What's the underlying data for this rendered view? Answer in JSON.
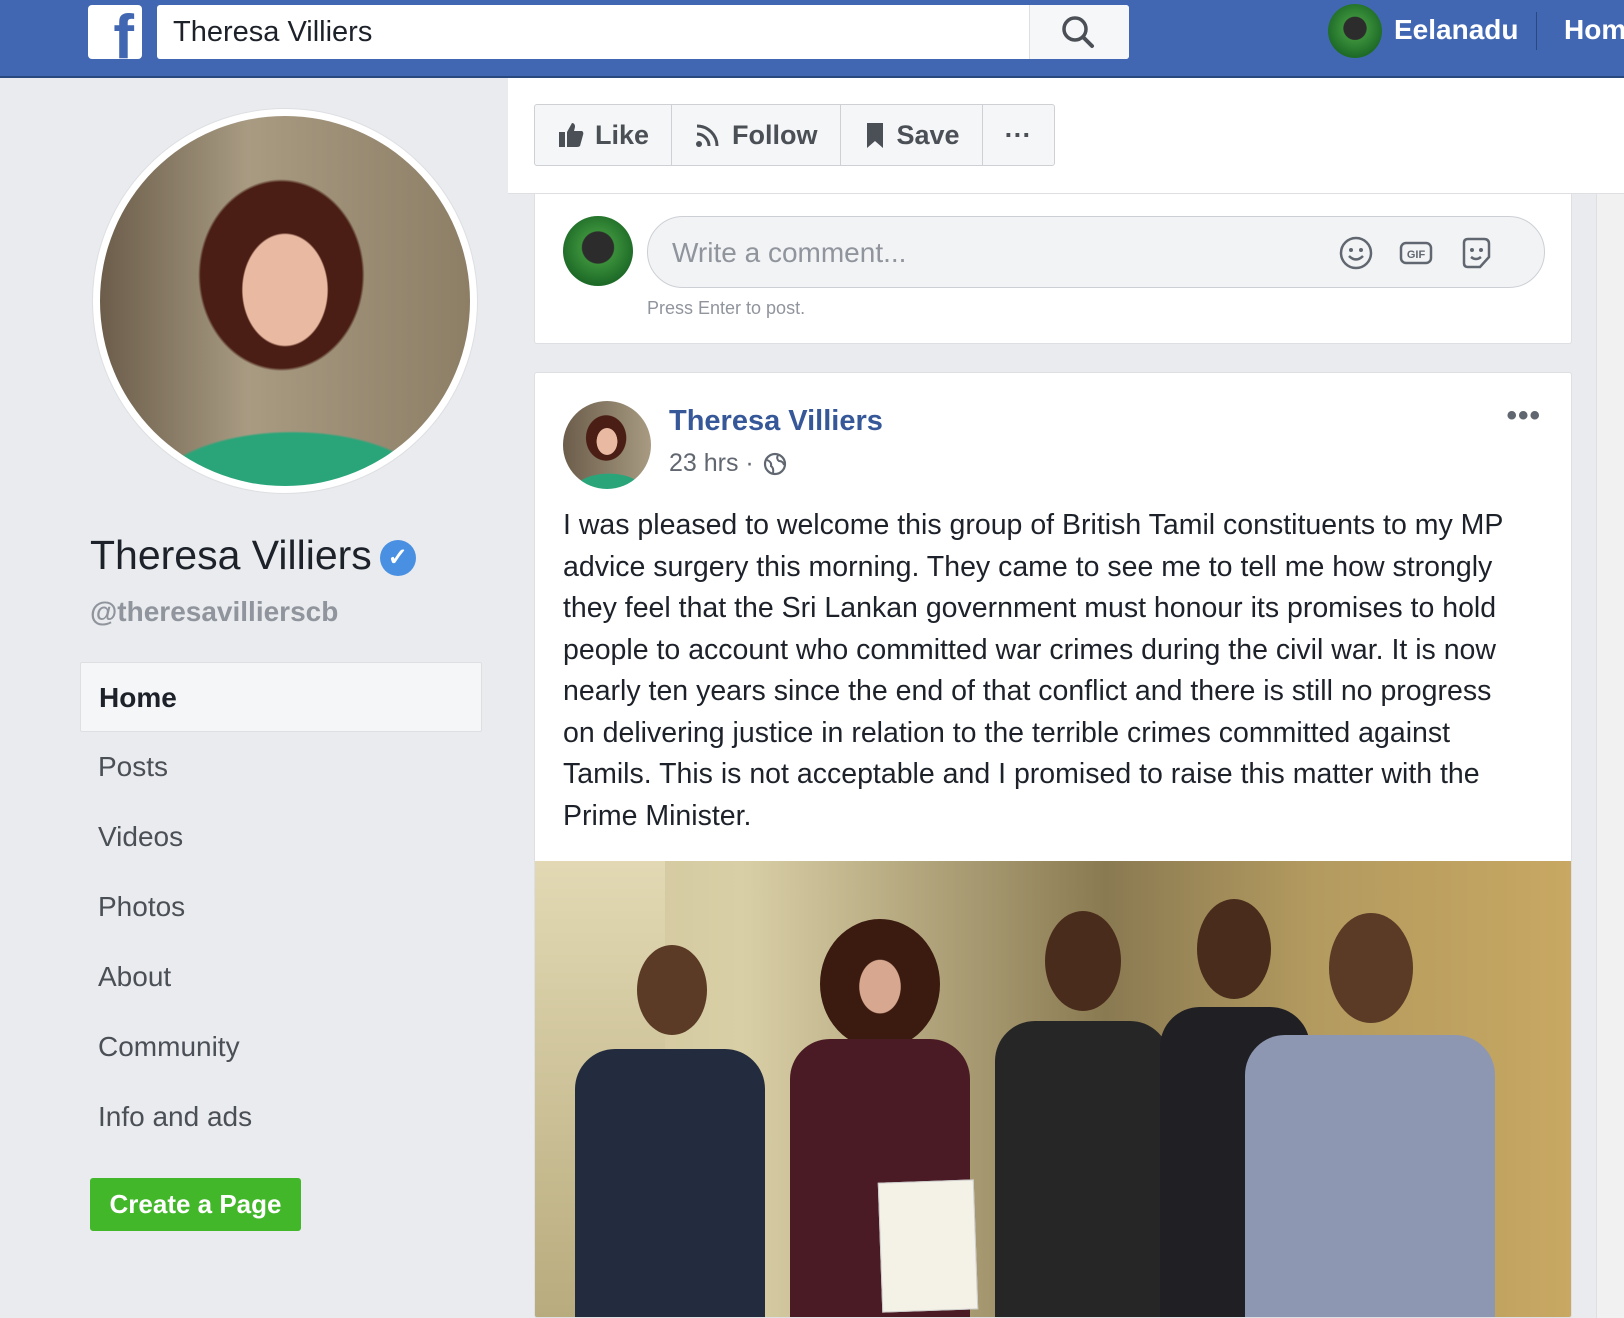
{
  "topbar": {
    "search_value": "Theresa Villiers",
    "user_name": "Eelanadu",
    "home_label": "Home"
  },
  "profile": {
    "name": "Theresa Villiers",
    "handle": "@theresavillierscb",
    "verified_mark": "✓"
  },
  "nav": {
    "items": [
      {
        "label": "Home"
      },
      {
        "label": "Posts"
      },
      {
        "label": "Videos"
      },
      {
        "label": "Photos"
      },
      {
        "label": "About"
      },
      {
        "label": "Community"
      },
      {
        "label": "Info and ads"
      }
    ],
    "create_page": "Create a Page"
  },
  "actions": {
    "like": "Like",
    "follow": "Follow",
    "save": "Save",
    "more": "···"
  },
  "comment": {
    "placeholder": "Write a comment...",
    "hint": "Press Enter to post."
  },
  "post": {
    "author": "Theresa Villiers",
    "time": "23 hrs ·",
    "more": "•••",
    "text": "I was pleased to welcome this group of British Tamil constituents to my MP advice surgery this morning. They came to see me to tell me how strongly they feel that the Sri Lankan government must honour its promises to hold people to account who committed war crimes during the civil war. It is now nearly ten years since the end of that conflict and there is still no progress on delivering justice in relation to the terrible crimes committed against Tamils. This is not acceptable and I promised to raise this matter with the Prime Minister."
  },
  "colors": {
    "brand_blue": "#4267b2",
    "link_blue": "#365899",
    "create_green": "#42b72a"
  }
}
